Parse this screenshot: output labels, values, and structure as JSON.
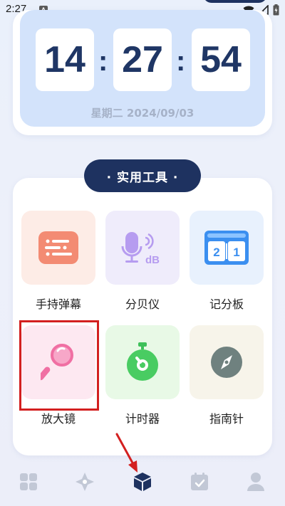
{
  "status": {
    "time": "2:27",
    "notification_letter": "A"
  },
  "clock": {
    "hours": "14",
    "minutes": "27",
    "seconds": "54",
    "separator": ":",
    "date": "星期二 2024/09/03"
  },
  "tools": {
    "title": "· 实用工具 ·",
    "items": [
      {
        "label": "手持弹幕",
        "icon": "danmaku-icon"
      },
      {
        "label": "分贝仪",
        "icon": "decibel-icon",
        "icon_text": "dB"
      },
      {
        "label": "记分板",
        "icon": "scoreboard-icon",
        "icon_text_left": "2",
        "icon_text_right": "1"
      },
      {
        "label": "放大镜",
        "icon": "magnifier-icon"
      },
      {
        "label": "计时器",
        "icon": "timer-icon"
      },
      {
        "label": "指南针",
        "icon": "compass-icon"
      }
    ]
  },
  "bottom_nav": {
    "items": [
      "home-icon",
      "discover-icon",
      "tools-icon",
      "calendar-icon",
      "profile-icon"
    ],
    "active": "tools-icon"
  },
  "colors": {
    "navy": "#1e3260",
    "highlight": "#d32020"
  }
}
